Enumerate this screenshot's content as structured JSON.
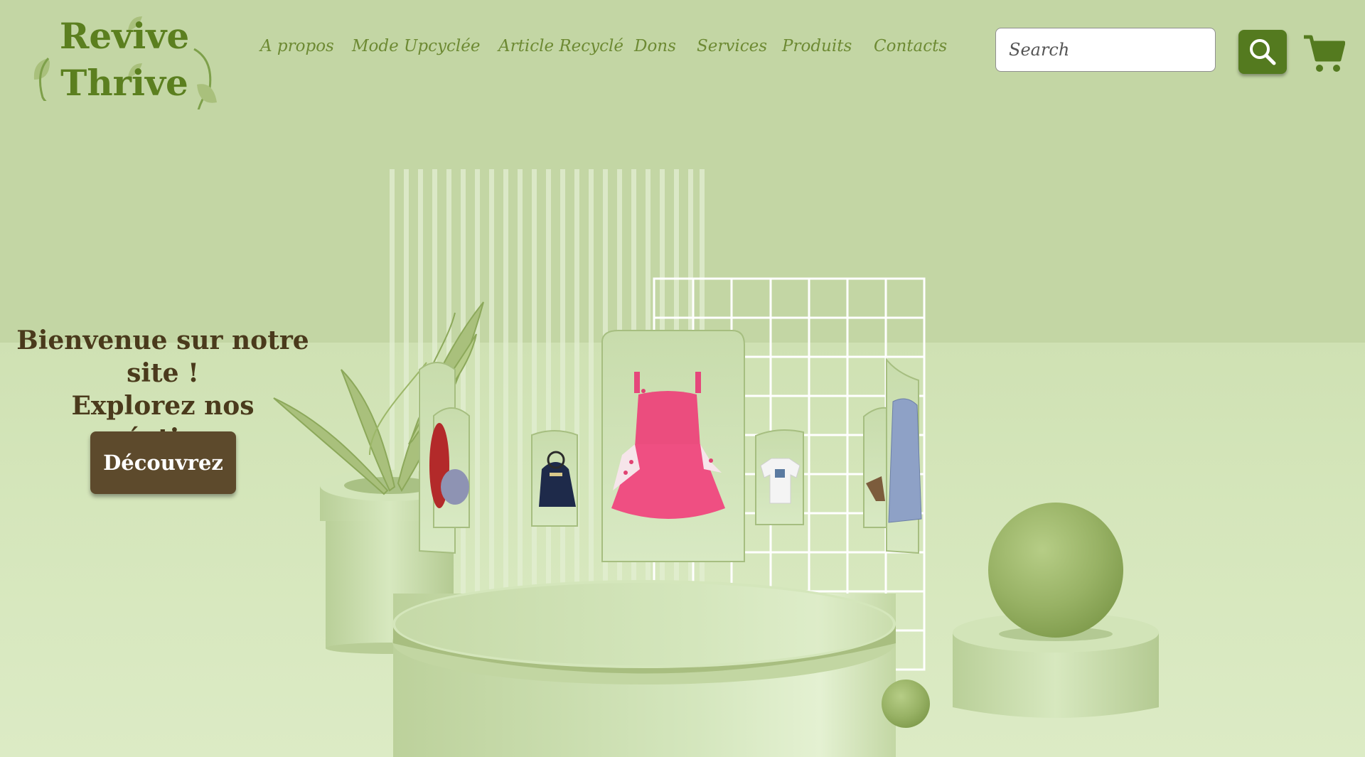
{
  "logo": {
    "line1": "Revive",
    "line2": "Thrive"
  },
  "nav": {
    "items": [
      {
        "label": "A propos"
      },
      {
        "label": "Mode Upcyclée"
      },
      {
        "label": "Article Recyclé"
      },
      {
        "label": "Dons"
      },
      {
        "label": "Services"
      },
      {
        "label": "Produits"
      },
      {
        "label": "Contacts"
      }
    ]
  },
  "search": {
    "placeholder": "Search",
    "value": ""
  },
  "icons": {
    "search": "search-icon",
    "cart": "cart-icon"
  },
  "hero": {
    "title_line1": "Bienvenue sur notre site !",
    "title_line2": "Explorez nos",
    "title_line3": "créations",
    "button_label": "Découvrez"
  },
  "colors": {
    "brand_green": "#5b7f1f",
    "nav_text": "#6d8a33",
    "search_button": "#547a1f",
    "hero_text": "#4a3a1c",
    "hero_button": "#5d4a2c",
    "background": "#c4d7a5"
  }
}
